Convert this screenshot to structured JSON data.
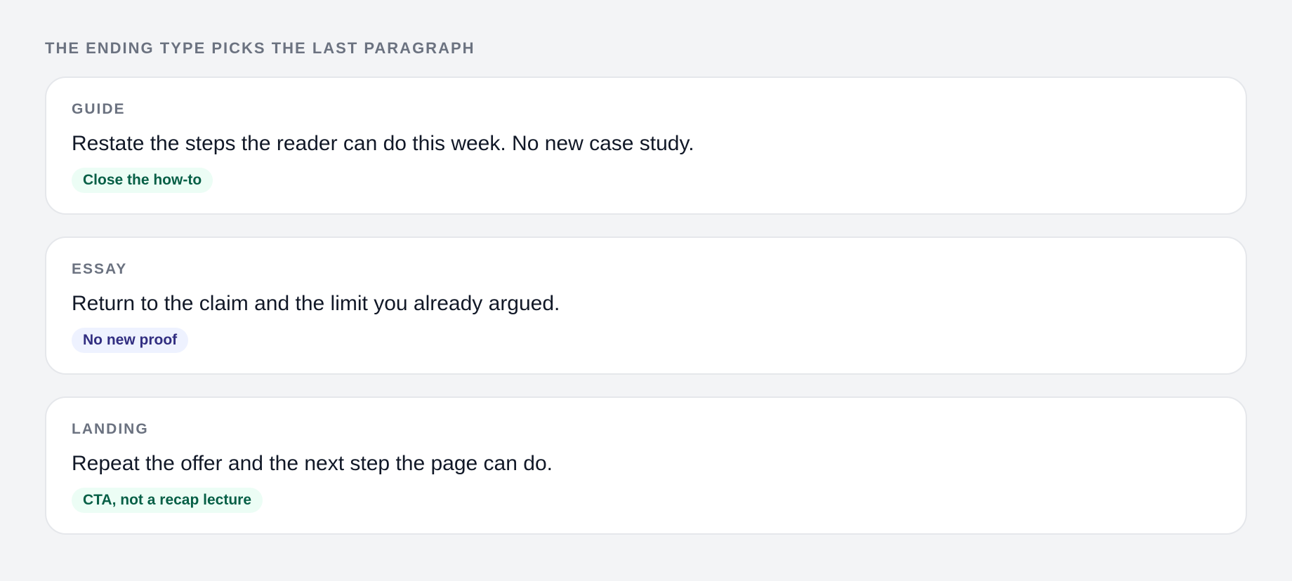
{
  "heading": "THE ENDING TYPE PICKS THE LAST PARAGRAPH",
  "cards": [
    {
      "label": "GUIDE",
      "text": "Restate the steps the reader can do this week. No new case study.",
      "tag": "Close the how-to",
      "tag_color": "#065f46",
      "tag_bg": "#ecfdf5"
    },
    {
      "label": "ESSAY",
      "text": "Return to the claim and the limit you already argued.",
      "tag": "No new proof",
      "tag_color": "#312e81",
      "tag_bg": "#eef2ff"
    },
    {
      "label": "LANDING",
      "text": "Repeat the offer and the next step the page can do.",
      "tag": "CTA, not a recap lecture",
      "tag_color": "#065f46",
      "tag_bg": "#ecfdf5"
    }
  ]
}
